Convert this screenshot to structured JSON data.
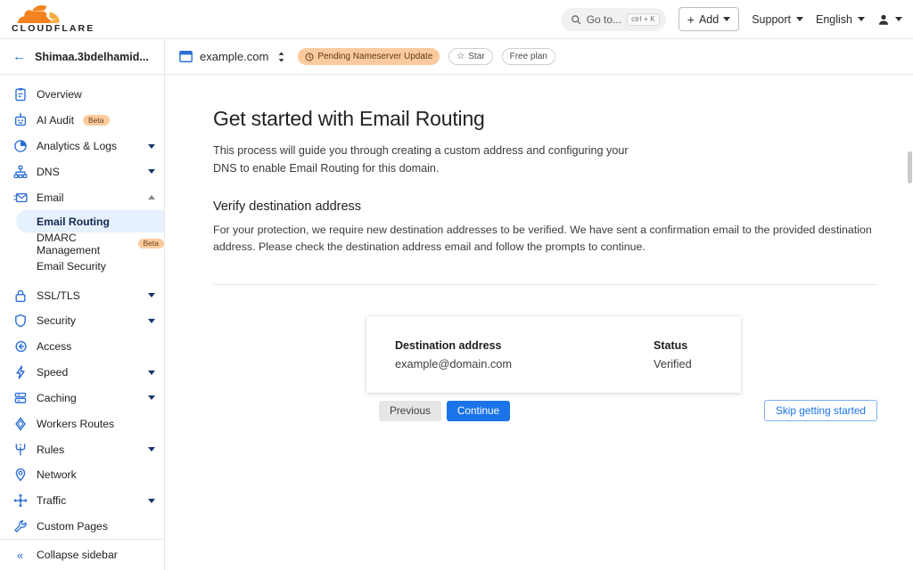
{
  "topbar": {
    "logo_word": "CLOUDFLARE",
    "search": {
      "placeholder": "Go to...",
      "kbd": "ctrl + K",
      "icon": "search-icon"
    },
    "add_label": "Add",
    "support_label": "Support",
    "language_label": "English"
  },
  "breadcrumb": {
    "back_icon": "arrow-left-icon",
    "account": "Shimaa.3bdelhamid...",
    "zone_icon": "browser-window-icon",
    "zone": "example.com",
    "zone_switch_icon": "chevron-up-down-icon",
    "status_pill": "Pending Nameserver Update",
    "status_pill_icon": "clock-icon",
    "star_label": "Star",
    "star_icon": "star-icon",
    "plan_label": "Free plan"
  },
  "sidebar": {
    "items": [
      {
        "label": "Overview",
        "icon": "clipboard-icon",
        "chevron": false,
        "badge": null
      },
      {
        "label": "AI Audit",
        "icon": "robot-icon",
        "chevron": false,
        "badge": "Beta"
      },
      {
        "label": "Analytics & Logs",
        "icon": "pie-chart-icon",
        "chevron": true,
        "badge": null
      },
      {
        "label": "DNS",
        "icon": "sitemap-icon",
        "chevron": true,
        "badge": null
      },
      {
        "label": "Email",
        "icon": "envelope-icon",
        "chevron": true,
        "expanded": true,
        "badge": null
      },
      {
        "label": "SSL/TLS",
        "icon": "lock-icon",
        "chevron": true,
        "badge": null
      },
      {
        "label": "Security",
        "icon": "shield-icon",
        "chevron": true,
        "badge": null
      },
      {
        "label": "Access",
        "icon": "access-arrow-icon",
        "chevron": false,
        "badge": null
      },
      {
        "label": "Speed",
        "icon": "lightning-icon",
        "chevron": true,
        "badge": null
      },
      {
        "label": "Caching",
        "icon": "database-icon",
        "chevron": true,
        "badge": null
      },
      {
        "label": "Workers Routes",
        "icon": "diamond-icon",
        "chevron": false,
        "badge": null
      },
      {
        "label": "Rules",
        "icon": "trident-icon",
        "chevron": true,
        "badge": null
      },
      {
        "label": "Network",
        "icon": "map-pin-icon",
        "chevron": false,
        "badge": null
      },
      {
        "label": "Traffic",
        "icon": "nodes-icon",
        "chevron": true,
        "badge": null
      },
      {
        "label": "Custom Pages",
        "icon": "wrench-icon",
        "chevron": false,
        "badge": null
      }
    ],
    "email_subitems": [
      {
        "label": "Email Routing",
        "active": true,
        "badge": null
      },
      {
        "label": "DMARC Management",
        "active": false,
        "badge": "Beta"
      },
      {
        "label": "Email Security",
        "active": false,
        "badge": null
      }
    ],
    "collapse_label": "Collapse sidebar",
    "collapse_icon": "chevrons-left-icon"
  },
  "main": {
    "title": "Get started with Email Routing",
    "lead": "This process will guide you through creating a custom address and configuring your DNS to enable Email Routing for this domain.",
    "section_title": "Verify destination address",
    "section_body": "For your protection, we require new destination addresses to be verified. We have sent a confirmation email to the provided destination address. Please check the destination address email and follow the prompts to continue.",
    "card": {
      "address_header": "Destination address",
      "address_value": "example@domain.com",
      "status_header": "Status",
      "status_value": "Verified"
    },
    "buttons": {
      "previous": "Previous",
      "continue": "Continue",
      "skip": "Skip getting started"
    }
  },
  "colors": {
    "brand_orange": "#f6821f",
    "accent_blue": "#1a73e8",
    "nav_icon_blue": "#2d6fd6",
    "active_nav_bg": "#e7f0fd",
    "pending_pill_bg": "#fbcb9e",
    "beta_badge_bg": "#fbcb9e"
  }
}
